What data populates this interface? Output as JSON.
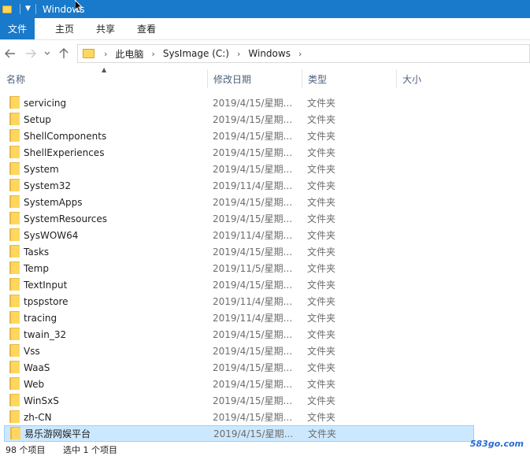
{
  "titlebar": {
    "title": "Windows"
  },
  "ribbon": {
    "tabs": [
      "文件",
      "主页",
      "共享",
      "查看"
    ]
  },
  "address": {
    "crumbs": [
      "此电脑",
      "SysImage (C:)",
      "Windows"
    ]
  },
  "columns": {
    "name": "名称",
    "date": "修改日期",
    "type": "类型",
    "size": "大小"
  },
  "files": [
    {
      "name": "servicing",
      "date": "2019/4/15/星期...",
      "type": "文件夹"
    },
    {
      "name": "Setup",
      "date": "2019/4/15/星期...",
      "type": "文件夹"
    },
    {
      "name": "ShellComponents",
      "date": "2019/4/15/星期...",
      "type": "文件夹"
    },
    {
      "name": "ShellExperiences",
      "date": "2019/4/15/星期...",
      "type": "文件夹"
    },
    {
      "name": "System",
      "date": "2019/4/15/星期...",
      "type": "文件夹"
    },
    {
      "name": "System32",
      "date": "2019/11/4/星期...",
      "type": "文件夹"
    },
    {
      "name": "SystemApps",
      "date": "2019/4/15/星期...",
      "type": "文件夹"
    },
    {
      "name": "SystemResources",
      "date": "2019/4/15/星期...",
      "type": "文件夹"
    },
    {
      "name": "SysWOW64",
      "date": "2019/11/4/星期...",
      "type": "文件夹"
    },
    {
      "name": "Tasks",
      "date": "2019/4/15/星期...",
      "type": "文件夹"
    },
    {
      "name": "Temp",
      "date": "2019/11/5/星期...",
      "type": "文件夹"
    },
    {
      "name": "TextInput",
      "date": "2019/4/15/星期...",
      "type": "文件夹"
    },
    {
      "name": "tpspstore",
      "date": "2019/11/4/星期...",
      "type": "文件夹"
    },
    {
      "name": "tracing",
      "date": "2019/11/4/星期...",
      "type": "文件夹"
    },
    {
      "name": "twain_32",
      "date": "2019/4/15/星期...",
      "type": "文件夹"
    },
    {
      "name": "Vss",
      "date": "2019/4/15/星期...",
      "type": "文件夹"
    },
    {
      "name": "WaaS",
      "date": "2019/4/15/星期...",
      "type": "文件夹"
    },
    {
      "name": "Web",
      "date": "2019/4/15/星期...",
      "type": "文件夹"
    },
    {
      "name": "WinSxS",
      "date": "2019/4/15/星期...",
      "type": "文件夹"
    },
    {
      "name": "zh-CN",
      "date": "2019/4/15/星期...",
      "type": "文件夹"
    },
    {
      "name": "易乐游网娱平台",
      "date": "2019/4/15/星期...",
      "type": "文件夹",
      "selected": true
    }
  ],
  "status": {
    "count": "98 个项目",
    "selected": "选中 1 个项目"
  },
  "watermark": "583go.com"
}
